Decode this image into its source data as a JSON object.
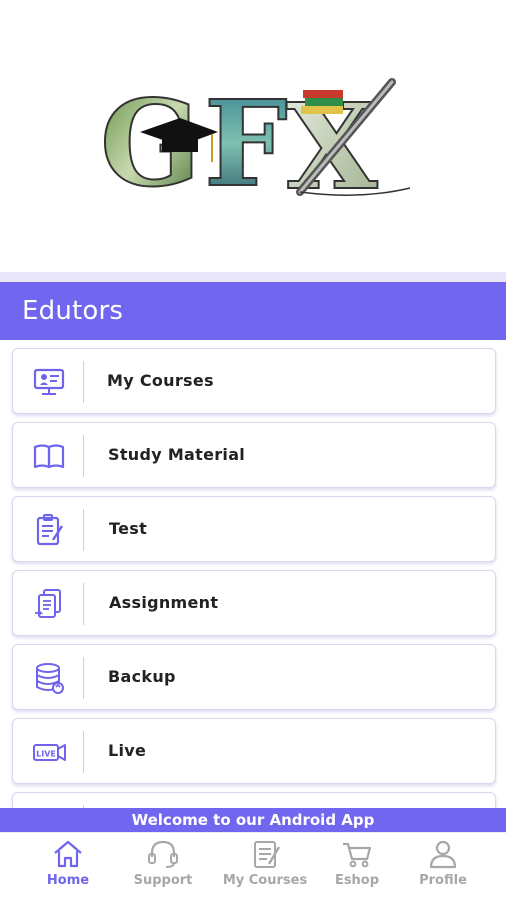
{
  "logo": {
    "text": "GFX"
  },
  "header": {
    "title": "Edutors"
  },
  "menu": [
    {
      "label": "My Courses",
      "icon": "presentation-screen-icon"
    },
    {
      "label": "Study Material",
      "icon": "open-book-icon"
    },
    {
      "label": "Test",
      "icon": "clipboard-checklist-icon"
    },
    {
      "label": "Assignment",
      "icon": "documents-assignment-icon"
    },
    {
      "label": "Backup",
      "icon": "database-backup-icon"
    },
    {
      "label": "Live",
      "icon": "live-camera-icon"
    }
  ],
  "banner": {
    "text": "Welcome to our Android App"
  },
  "bottom_nav": [
    {
      "label": "Home",
      "icon": "home-icon",
      "active": true
    },
    {
      "label": "Support",
      "icon": "headset-icon",
      "active": false
    },
    {
      "label": "My Courses",
      "icon": "courses-list-icon",
      "active": false
    },
    {
      "label": "Eshop",
      "icon": "shopping-cart-icon",
      "active": false
    },
    {
      "label": "Profile",
      "icon": "user-profile-icon",
      "active": false
    }
  ],
  "colors": {
    "accent": "#7166f0",
    "inactive": "#a7a7a7",
    "icon": "#6f64ee"
  }
}
